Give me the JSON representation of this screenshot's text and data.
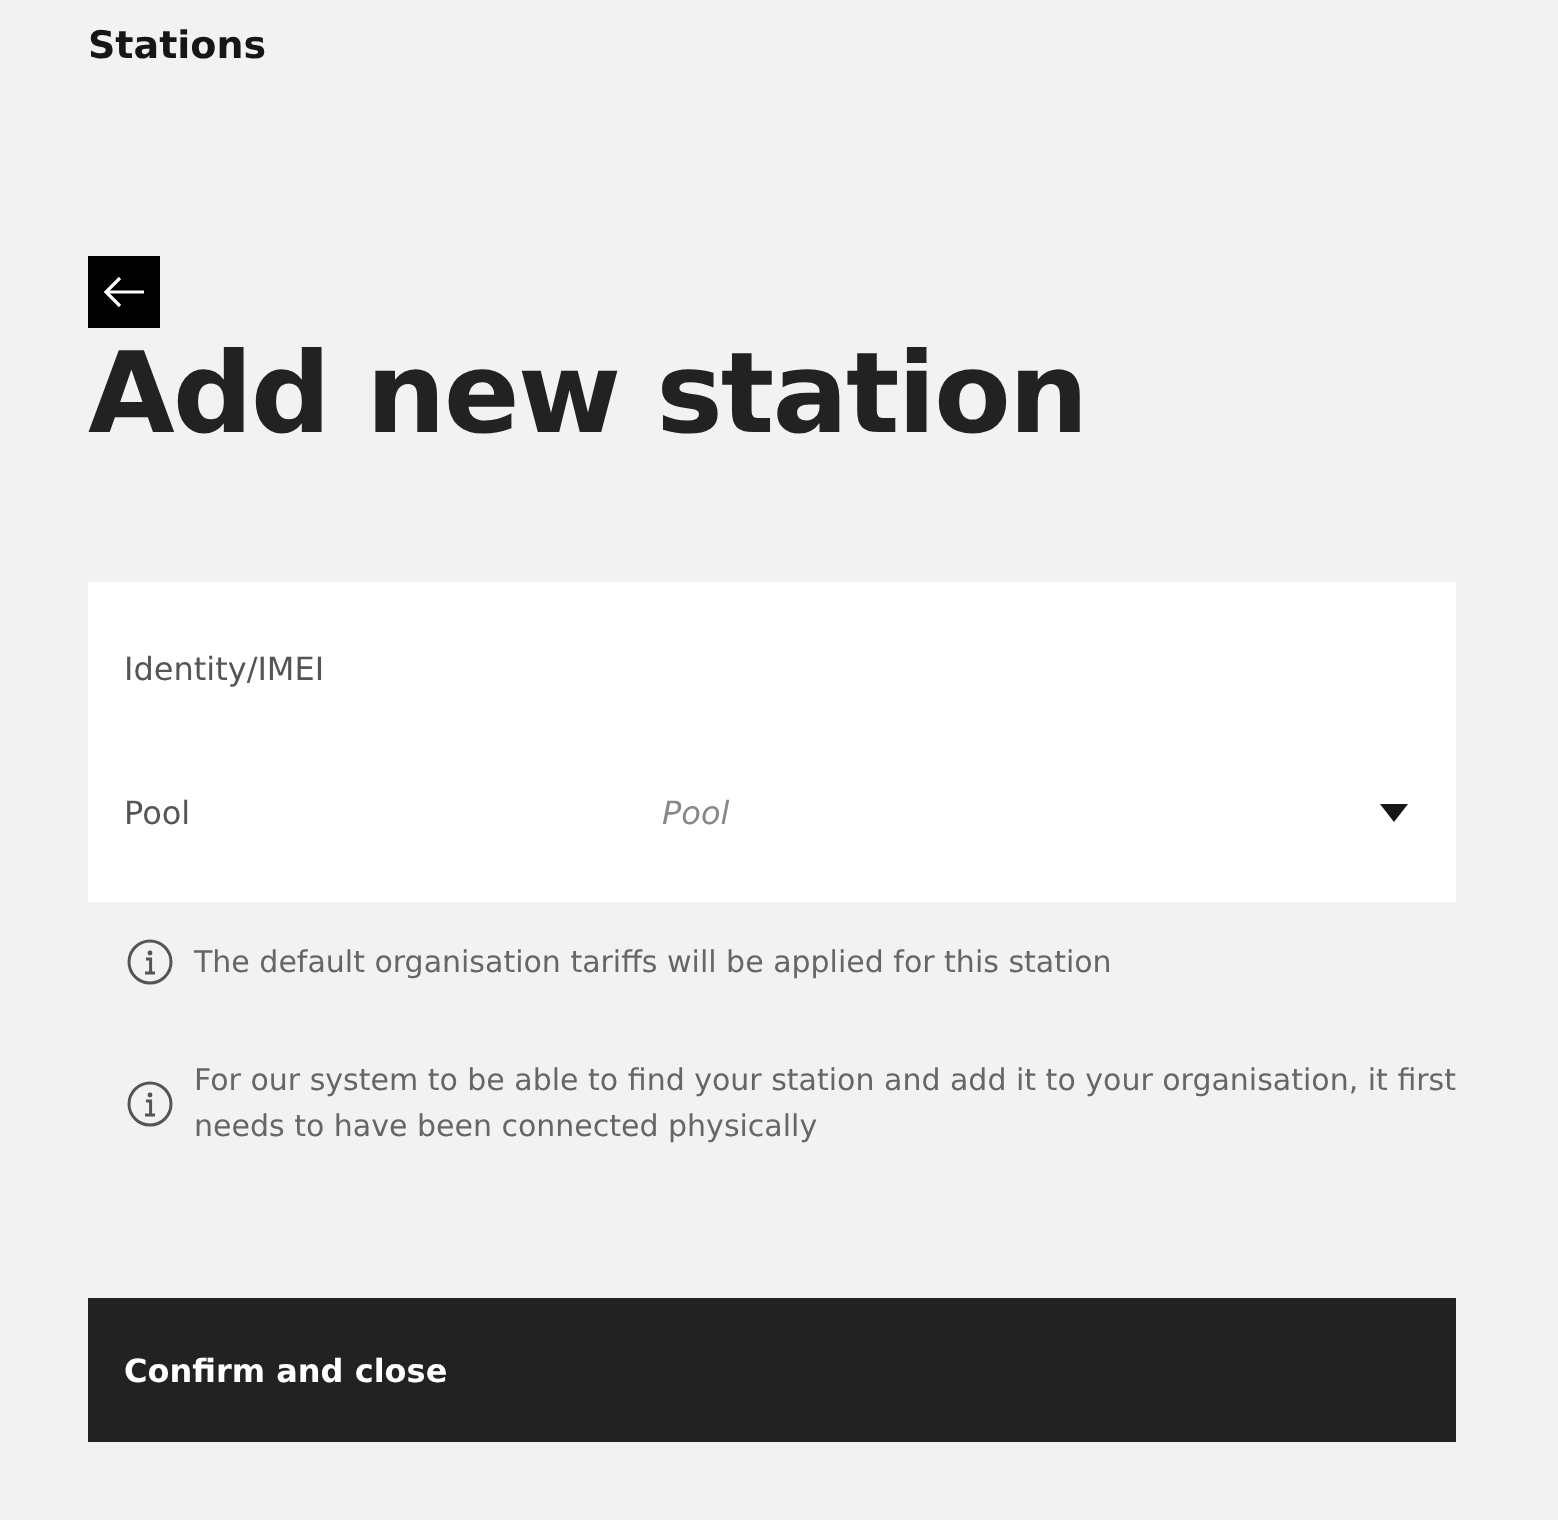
{
  "breadcrumb": "Stations",
  "title": "Add new station",
  "form": {
    "fields": [
      {
        "kind": "text",
        "label": "Identity/IMEI"
      },
      {
        "kind": "select",
        "label": "Pool",
        "placeholder": "Pool"
      }
    ]
  },
  "notes": [
    "The default organisation tariffs will be applied for this station",
    "For our system to be able to find your station and add it to your organisation, it first needs to have been connected physically"
  ],
  "confirm_button": "Confirm and close"
}
